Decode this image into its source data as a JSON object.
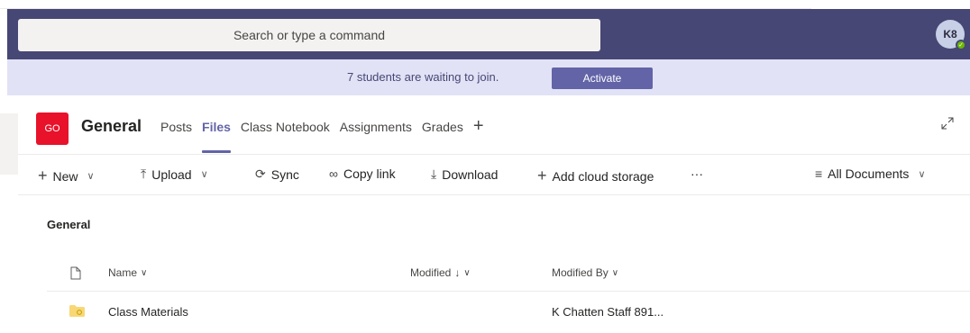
{
  "titlebar": {
    "search_placeholder": "Search or type a command",
    "avatar_initials": "K8"
  },
  "notice": {
    "text": "7 students are waiting to join.",
    "action_label": "Activate"
  },
  "channel": {
    "team_initials": "GO",
    "name": "General",
    "tabs": [
      {
        "label": "Posts",
        "active": false
      },
      {
        "label": "Files",
        "active": true
      },
      {
        "label": "Class Notebook",
        "active": false
      },
      {
        "label": "Assignments",
        "active": false
      },
      {
        "label": "Grades",
        "active": false
      }
    ],
    "add_tab_icon": "plus-icon",
    "expand_icon": "expand-icon"
  },
  "toolbar": {
    "new_label": "New",
    "upload_label": "Upload",
    "sync_label": "Sync",
    "copy_link_label": "Copy link",
    "download_label": "Download",
    "add_cloud_label": "Add cloud storage",
    "more_label": "···",
    "view_label": "All Documents"
  },
  "files": {
    "section_title": "General",
    "columns": {
      "name": "Name",
      "modified": "Modified",
      "modified_by": "Modified By"
    },
    "rows": [
      {
        "name": "Class Materials",
        "modified": "",
        "modified_by": "K Chatten Staff 891..."
      }
    ]
  },
  "colors": {
    "brand": "#464775",
    "accent": "#6264a7",
    "team_tile": "#e8122b",
    "notice_bg": "#e2e2f6"
  }
}
